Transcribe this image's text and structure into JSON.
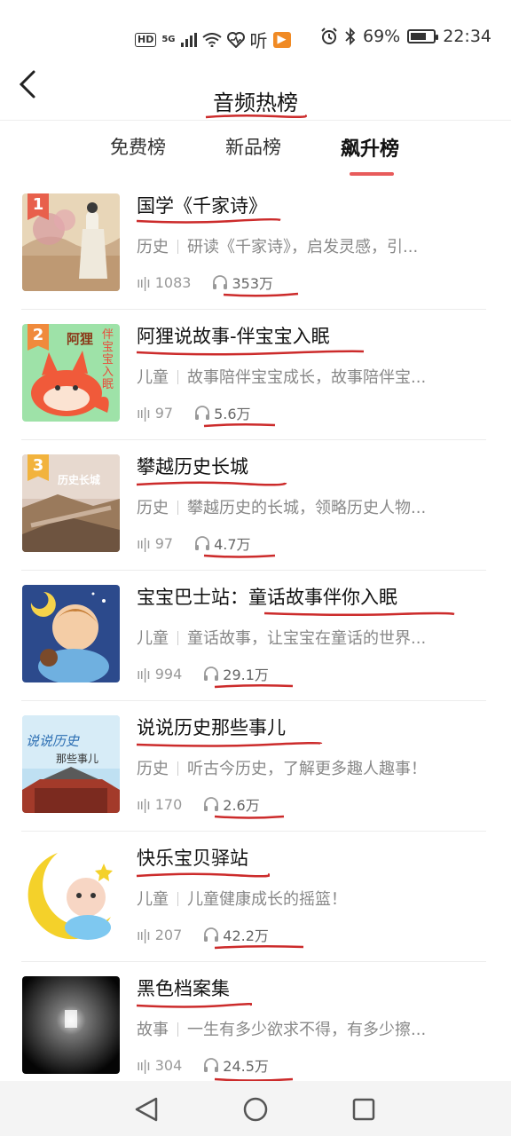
{
  "status_bar": {
    "left_icons": [
      "HD",
      "5G",
      "signal-icon",
      "wifi-icon",
      "heart-icon",
      "听",
      "play-icon"
    ],
    "hd": "HD",
    "net": "5G",
    "listen_char": "听",
    "battery_percent_label": "69%",
    "battery_level": 0.69,
    "time": "22:34"
  },
  "header": {
    "title": "音频热榜"
  },
  "tabs": [
    {
      "label": "免费榜",
      "active": false
    },
    {
      "label": "新品榜",
      "active": false
    },
    {
      "label": "飙升榜",
      "active": true
    }
  ],
  "items": [
    {
      "rank": "1",
      "title": "国学《千家诗》",
      "category": "历史",
      "desc": "研读《千家诗》，启发灵感，引...",
      "episodes": "1083",
      "plays": "353万",
      "rank_color": "#e8604c"
    },
    {
      "rank": "2",
      "title": "阿狸说故事-伴宝宝入眠",
      "category": "儿童",
      "desc": "故事陪伴宝宝成长，故事陪伴宝...",
      "episodes": "97",
      "plays": "5.6万",
      "rank_color": "#f08a3c",
      "cover_text_a": "阿狸",
      "cover_text_b": "伴宝宝入眠"
    },
    {
      "rank": "3",
      "title": "攀越历史长城",
      "category": "历史",
      "desc": "攀越历史的长城，领略历史人物...",
      "episodes": "97",
      "plays": "4.7万",
      "rank_color": "#f2b33d",
      "cover_text_a": "历史长城"
    },
    {
      "rank": "",
      "title": "宝宝巴士站：童话故事伴你入眠",
      "category": "儿童",
      "desc": "童话故事，让宝宝在童话的世界...",
      "episodes": "994",
      "plays": "29.1万"
    },
    {
      "rank": "",
      "title": "说说历史那些事儿",
      "category": "历史",
      "desc": "听古今历史，了解更多趣人趣事！",
      "episodes": "170",
      "plays": "2.6万",
      "cover_text_a": "说说历史",
      "cover_text_b": "那些事儿"
    },
    {
      "rank": "",
      "title": "快乐宝贝驿站",
      "category": "儿童",
      "desc": "儿童健康成长的摇篮！",
      "episodes": "207",
      "plays": "42.2万"
    },
    {
      "rank": "",
      "title": "黑色档案集",
      "category": "故事",
      "desc": "一生有多少欲求不得，有多少擦...",
      "episodes": "304",
      "plays": "24.5万"
    }
  ],
  "colors": {
    "accent": "#e85b5b",
    "annotation": "#cc2b2b"
  },
  "nav": [
    "back-triangle-icon",
    "home-circle-icon",
    "recents-square-icon"
  ]
}
